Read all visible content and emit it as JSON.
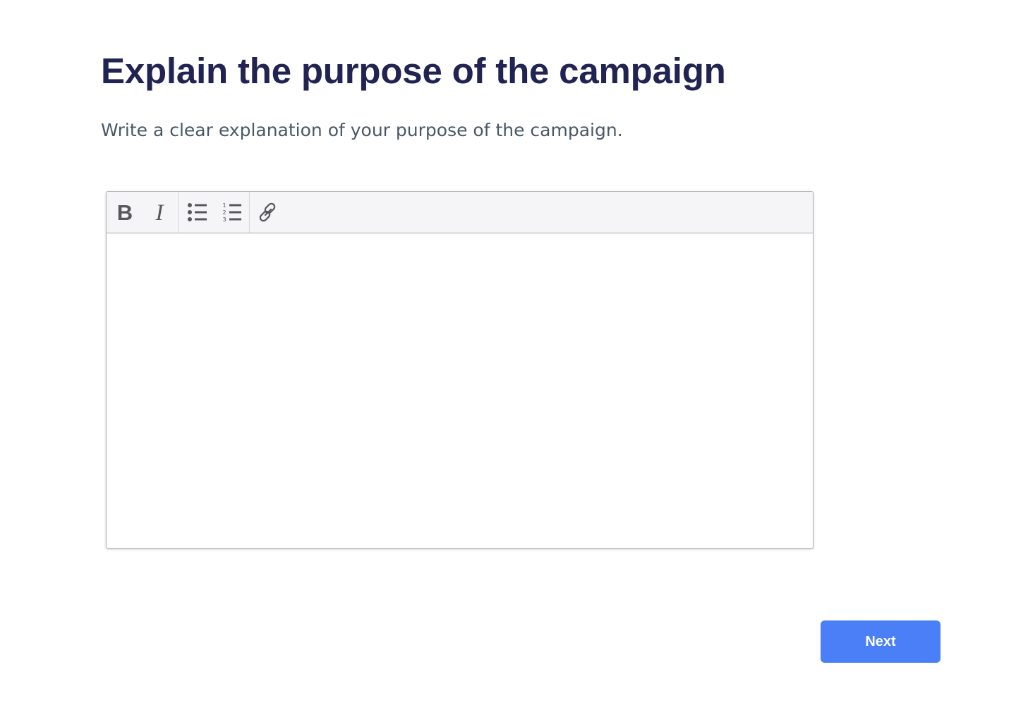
{
  "page": {
    "title": "Explain the purpose of the campaign",
    "subtitle": "Write a clear explanation of your purpose of the campaign."
  },
  "editor": {
    "content": "",
    "toolbar": {
      "groups": [
        [
          "bold-icon",
          "italic-icon"
        ],
        [
          "bulleted-list-icon",
          "numbered-list-icon"
        ],
        [
          "link-icon"
        ]
      ],
      "icon_color": "#59565c"
    }
  },
  "actions": {
    "next_label": "Next",
    "accent_color": "#4a7ff7"
  },
  "colors": {
    "title": "#212452",
    "subtitle": "#4a5866",
    "toolbar_bg": "#f5f4f7"
  }
}
